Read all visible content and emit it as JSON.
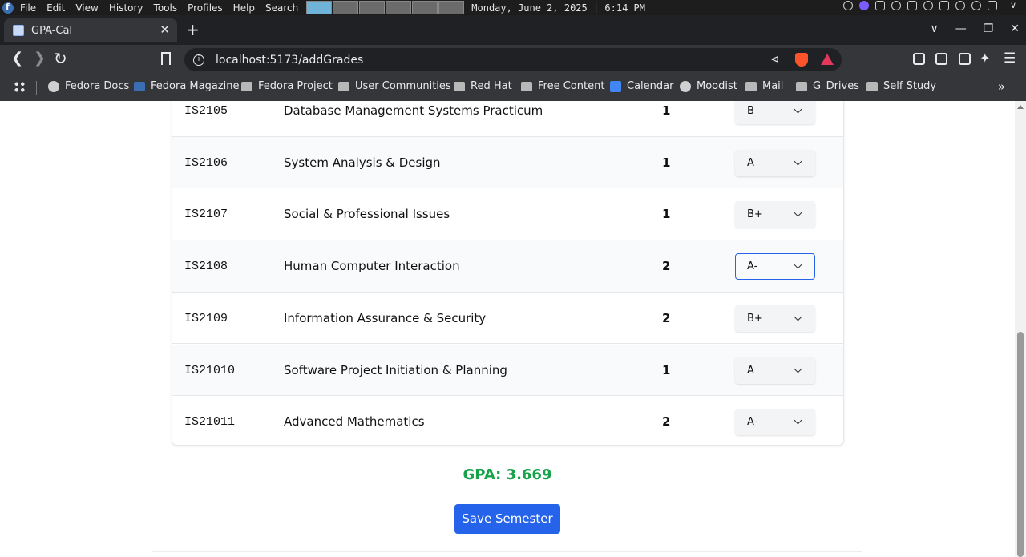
{
  "system_bar": {
    "menu": [
      "File",
      "Edit",
      "View",
      "History",
      "Tools",
      "Profiles",
      "Help",
      "Search"
    ],
    "clock": "Monday, June 2, 2025 │ 6:14 PM"
  },
  "browser": {
    "tab_title": "GPA-Cal",
    "url": "localhost:5173/addGrades",
    "bookmarks": [
      "Fedora Docs",
      "Fedora Magazine",
      "Fedora Project",
      "User Communities",
      "Red Hat",
      "Free Content",
      "Calendar",
      "Moodist",
      "Mail",
      "G_Drives",
      "Self Study"
    ]
  },
  "courses": [
    {
      "code": "IS2105",
      "name": "Database Management Systems Practicum",
      "credits": "1",
      "grade": "B"
    },
    {
      "code": "IS2106",
      "name": "System Analysis & Design",
      "credits": "1",
      "grade": "A"
    },
    {
      "code": "IS2107",
      "name": "Social & Professional Issues",
      "credits": "1",
      "grade": "B+"
    },
    {
      "code": "IS2108",
      "name": "Human Computer Interaction",
      "credits": "2",
      "grade": "A-"
    },
    {
      "code": "IS2109",
      "name": "Information Assurance & Security",
      "credits": "2",
      "grade": "B+"
    },
    {
      "code": "IS21010",
      "name": "Software Project Initiation & Planning",
      "credits": "1",
      "grade": "A"
    },
    {
      "code": "IS21011",
      "name": "Advanced Mathematics",
      "credits": "2",
      "grade": "A-"
    }
  ],
  "gpa_text": "GPA: 3.669",
  "save_label": "Save Semester",
  "colors": {
    "gpa": "#16a34a",
    "button": "#2563eb",
    "focus": "#2563eb"
  }
}
